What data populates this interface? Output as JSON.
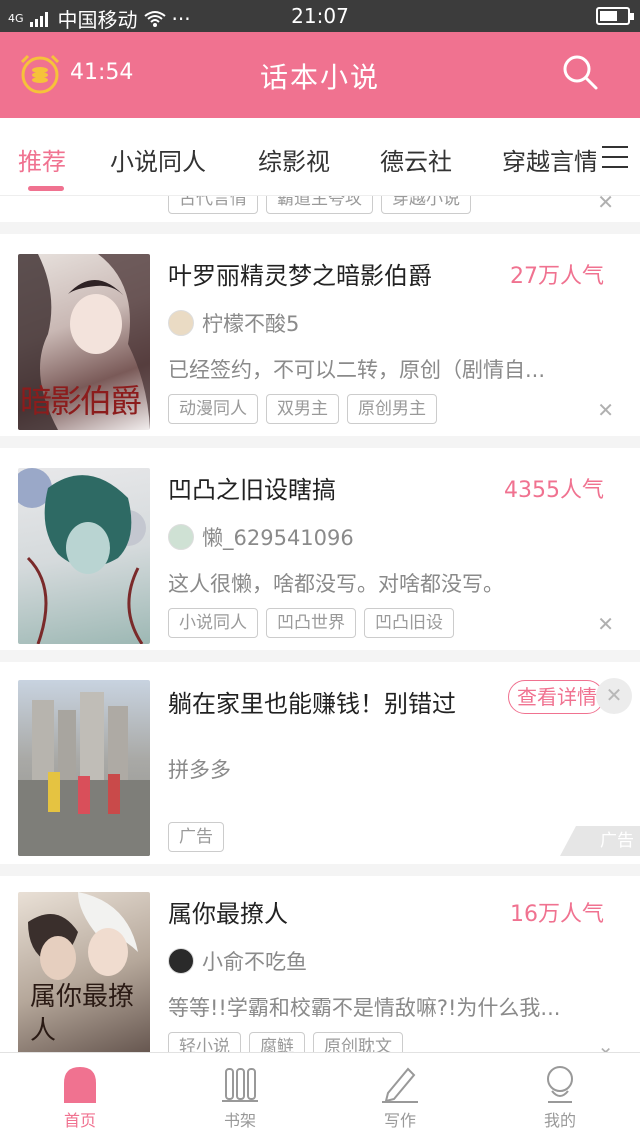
{
  "status_bar": {
    "network": "4G",
    "carrier": "中国移动",
    "more": "···",
    "time": "21:07"
  },
  "header": {
    "timer": "41:54",
    "title": "话本小说"
  },
  "tabs": [
    "推荐",
    "小说同人",
    "综影视",
    "德云社",
    "穿越言情"
  ],
  "feed": {
    "previous_tags": [
      "古代言情",
      "霸道主夸攻",
      "穿越小说"
    ],
    "cards": [
      {
        "title": "叶罗丽精灵梦之暗影伯爵",
        "popularity": "27万人气",
        "author": "柠檬不酸5",
        "description": "已经签约，不可以二转，原创（剧情自...",
        "tags": [
          "动漫同人",
          "双男主",
          "原创男主"
        ],
        "cover_text": "暗影伯爵"
      },
      {
        "title": "凹凸之旧设瞎搞",
        "popularity": "4355人气",
        "author": "懒_629541096",
        "description": "这人很懒，啥都没写。对啥都没写。",
        "tags": [
          "小说同人",
          "凹凸世界",
          "凹凸旧设"
        ]
      },
      {
        "title": "躺在家里也能赚钱！别错过",
        "author": "拼多多",
        "cta": "查看详情",
        "tags": [
          "广告"
        ],
        "ad_mark": "广告"
      },
      {
        "title": "属你最撩人",
        "popularity": "16万人气",
        "author": "小俞不吃鱼",
        "description": "等等!!学霸和校霸不是情敌嘛?!为什么我...",
        "tags": [
          "轻小说",
          "腐鲢",
          "原创耽文"
        ],
        "cover_text": "属你最撩人"
      }
    ]
  },
  "bottom_nav": [
    {
      "label": "首页",
      "icon": "home-icon",
      "active": true
    },
    {
      "label": "书架",
      "icon": "bookshelf-icon",
      "active": false
    },
    {
      "label": "写作",
      "icon": "pen-icon",
      "active": false
    },
    {
      "label": "我的",
      "icon": "user-icon",
      "active": false
    }
  ],
  "colors": {
    "accent": "#f07290",
    "status_bar": "#3c3c3c",
    "text": "#222222",
    "muted": "#8a8a8a"
  }
}
